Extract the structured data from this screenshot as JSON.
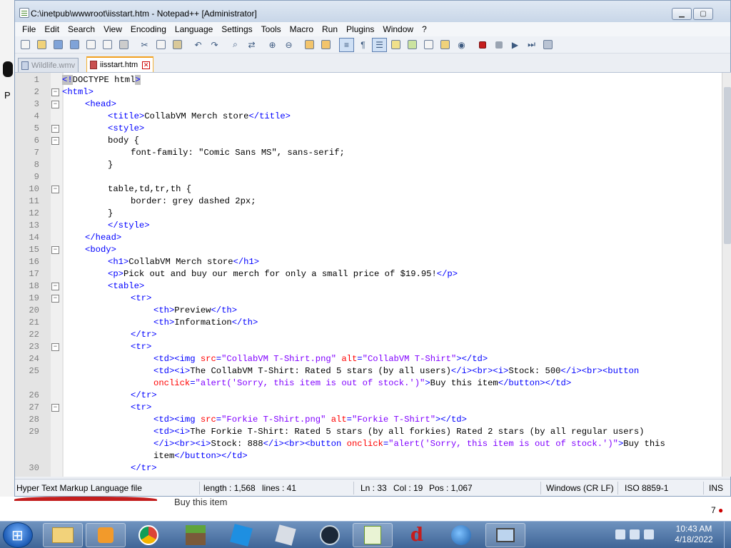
{
  "window": {
    "title": "C:\\inetpub\\wwwroot\\iisstart.htm - Notepad++ [Administrator]",
    "minimize": "▁",
    "maximize": "▢",
    "close": "✕"
  },
  "menu": [
    "File",
    "Edit",
    "Search",
    "View",
    "Encoding",
    "Language",
    "Settings",
    "Tools",
    "Macro",
    "Run",
    "Plugins",
    "Window",
    "?"
  ],
  "tabs": [
    {
      "label": "Wildlife.wmv",
      "active": false
    },
    {
      "label": "iisstart.htm",
      "active": true
    }
  ],
  "code": [
    {
      "n": "1",
      "fold": "",
      "indent": 0,
      "s": [
        [
          "tg",
          "<!"
        ],
        [
          "tx",
          "DOCTYPE html"
        ],
        [
          "tg",
          ">"
        ]
      ]
    },
    {
      "n": "2",
      "fold": "−",
      "indent": 0,
      "s": [
        [
          "tg",
          "<html>"
        ]
      ]
    },
    {
      "n": "3",
      "fold": "−",
      "indent": 1,
      "s": [
        [
          "tg",
          "<head>"
        ]
      ]
    },
    {
      "n": "4",
      "fold": "",
      "indent": 2,
      "s": [
        [
          "tg",
          "<title>"
        ],
        [
          "tx",
          "CollabVM Merch store"
        ],
        [
          "tg",
          "</title>"
        ]
      ]
    },
    {
      "n": "5",
      "fold": "−",
      "indent": 2,
      "s": [
        [
          "tg",
          "<style>"
        ]
      ]
    },
    {
      "n": "6",
      "fold": "−",
      "indent": 2,
      "s": [
        [
          "tx",
          "body {"
        ]
      ]
    },
    {
      "n": "7",
      "fold": "",
      "indent": 3,
      "s": [
        [
          "tx",
          "font-family: \"Comic Sans MS\", sans-serif;"
        ]
      ]
    },
    {
      "n": "8",
      "fold": "",
      "indent": 2,
      "s": [
        [
          "tx",
          "}"
        ]
      ]
    },
    {
      "n": "9",
      "fold": "",
      "indent": 0,
      "s": []
    },
    {
      "n": "10",
      "fold": "−",
      "indent": 2,
      "s": [
        [
          "tx",
          "table,td,tr,th {"
        ]
      ]
    },
    {
      "n": "11",
      "fold": "",
      "indent": 3,
      "s": [
        [
          "tx",
          "border: grey dashed 2px;"
        ]
      ]
    },
    {
      "n": "12",
      "fold": "",
      "indent": 2,
      "s": [
        [
          "tx",
          "}"
        ]
      ]
    },
    {
      "n": "13",
      "fold": "",
      "indent": 2,
      "s": [
        [
          "tg",
          "</style>"
        ]
      ]
    },
    {
      "n": "14",
      "fold": "",
      "indent": 1,
      "s": [
        [
          "tg",
          "</head>"
        ]
      ]
    },
    {
      "n": "15",
      "fold": "−",
      "indent": 1,
      "s": [
        [
          "tg",
          "<body>"
        ]
      ]
    },
    {
      "n": "16",
      "fold": "",
      "indent": 2,
      "s": [
        [
          "tg",
          "<h1>"
        ],
        [
          "tx",
          "CollabVM Merch store"
        ],
        [
          "tg",
          "</h1>"
        ]
      ]
    },
    {
      "n": "17",
      "fold": "",
      "indent": 2,
      "s": [
        [
          "tg",
          "<p>"
        ],
        [
          "tx",
          "Pick out and buy our merch for only a small price of $19.95!"
        ],
        [
          "tg",
          "</p>"
        ]
      ]
    },
    {
      "n": "18",
      "fold": "−",
      "indent": 2,
      "s": [
        [
          "tg",
          "<table>"
        ]
      ]
    },
    {
      "n": "19",
      "fold": "−",
      "indent": 3,
      "s": [
        [
          "tg",
          "<tr>"
        ]
      ]
    },
    {
      "n": "20",
      "fold": "",
      "indent": 4,
      "s": [
        [
          "tg",
          "<th>"
        ],
        [
          "tx",
          "Preview"
        ],
        [
          "tg",
          "</th>"
        ]
      ]
    },
    {
      "n": "21",
      "fold": "",
      "indent": 4,
      "s": [
        [
          "tg",
          "<th>"
        ],
        [
          "tx",
          "Information"
        ],
        [
          "tg",
          "</th>"
        ]
      ]
    },
    {
      "n": "22",
      "fold": "",
      "indent": 3,
      "s": [
        [
          "tg",
          "</tr>"
        ]
      ]
    },
    {
      "n": "23",
      "fold": "−",
      "indent": 3,
      "s": [
        [
          "tg",
          "<tr>"
        ]
      ]
    },
    {
      "n": "24",
      "fold": "",
      "indent": 4,
      "s": [
        [
          "tg",
          "<td><img "
        ],
        [
          "at",
          "src"
        ],
        [
          "tg",
          "="
        ],
        [
          "st",
          "\"CollabVM T-Shirt.png\""
        ],
        [
          "tg",
          " "
        ],
        [
          "at",
          "alt"
        ],
        [
          "tg",
          "="
        ],
        [
          "st",
          "\"CollabVM T-Shirt\""
        ],
        [
          "tg",
          "></td>"
        ]
      ]
    },
    {
      "n": "25",
      "fold": "",
      "indent": 4,
      "s": [
        [
          "tg",
          "<td><i>"
        ],
        [
          "tx",
          "The CollabVM T-Shirt: Rated 5 stars (by all users)"
        ],
        [
          "tg",
          "</i><br><i>"
        ],
        [
          "tx",
          "Stock: 500"
        ],
        [
          "tg",
          "</i><br><button"
        ]
      ]
    },
    {
      "n": "",
      "fold": "",
      "indent": 4,
      "s": [
        [
          "at",
          "onclick"
        ],
        [
          "tg",
          "="
        ],
        [
          "st",
          "\"alert('Sorry, this item is out of stock.')\""
        ],
        [
          "tg",
          ">"
        ],
        [
          "tx",
          "Buy this item"
        ],
        [
          "tg",
          "</button></td>"
        ]
      ]
    },
    {
      "n": "26",
      "fold": "",
      "indent": 3,
      "s": [
        [
          "tg",
          "</tr>"
        ]
      ]
    },
    {
      "n": "27",
      "fold": "−",
      "indent": 3,
      "s": [
        [
          "tg",
          "<tr>"
        ]
      ]
    },
    {
      "n": "28",
      "fold": "",
      "indent": 4,
      "s": [
        [
          "tg",
          "<td><img "
        ],
        [
          "at",
          "src"
        ],
        [
          "tg",
          "="
        ],
        [
          "st",
          "\"Forkie T-Shirt.png\""
        ],
        [
          "tg",
          " "
        ],
        [
          "at",
          "alt"
        ],
        [
          "tg",
          "="
        ],
        [
          "st",
          "\"Forkie T-Shirt\""
        ],
        [
          "tg",
          "></td>"
        ]
      ]
    },
    {
      "n": "29",
      "fold": "",
      "indent": 4,
      "s": [
        [
          "tg",
          "<td><i>"
        ],
        [
          "tx",
          "The Forkie T-Shirt: Rated 5 stars (by all forkies) Rated 2 stars (by all regular users)"
        ]
      ]
    },
    {
      "n": "",
      "fold": "",
      "indent": 4,
      "s": [
        [
          "tg",
          "</i><br><i>"
        ],
        [
          "tx",
          "Stock: 888"
        ],
        [
          "tg",
          "</i><br><button "
        ],
        [
          "at",
          "onclick"
        ],
        [
          "tg",
          "="
        ],
        [
          "st",
          "\"alert('Sorry, this item is out of stock.')\""
        ],
        [
          "tg",
          ">"
        ],
        [
          "tx",
          "Buy this"
        ]
      ]
    },
    {
      "n": "",
      "fold": "",
      "indent": 4,
      "s": [
        [
          "tx",
          "item"
        ],
        [
          "tg",
          "</button></td>"
        ]
      ]
    },
    {
      "n": "30",
      "fold": "",
      "indent": 3,
      "s": [
        [
          "tg",
          "</tr>"
        ]
      ]
    }
  ],
  "status": {
    "filetype": "Hyper Text Markup Language file",
    "length": "length : 1,568",
    "lines": "lines : 41",
    "ln": "Ln : 33",
    "col": "Col : 19",
    "pos": "Pos : 1,067",
    "eol": "Windows (CR LF)",
    "encoding": "ISO 8859-1",
    "mode": "INS"
  },
  "background": {
    "text": "Buy this item",
    "badge": "7"
  },
  "taskbar": {
    "time": "10:43 AM",
    "date": "4/18/2022"
  }
}
